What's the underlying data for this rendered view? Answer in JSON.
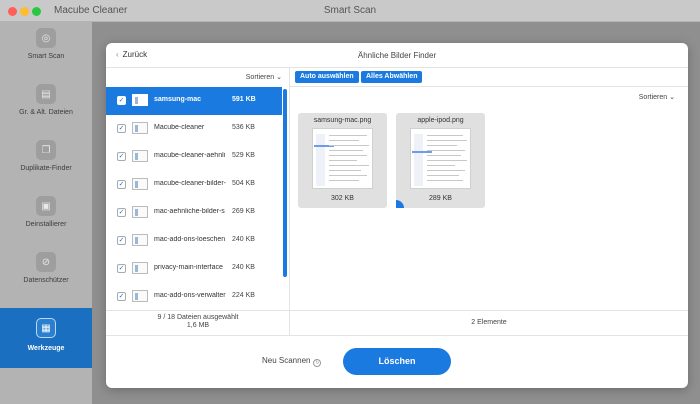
{
  "window": {
    "app_name": "Macube Cleaner",
    "title": "Smart Scan"
  },
  "sidebar": {
    "items": [
      {
        "label": "Smart Scan",
        "icon": "target-icon"
      },
      {
        "label": "Gr. & Alt. Dateien",
        "icon": "document-icon"
      },
      {
        "label": "Duplikate-Finder",
        "icon": "copy-icon"
      },
      {
        "label": "Deinstallierer",
        "icon": "package-icon"
      },
      {
        "label": "Datenschützer",
        "icon": "eye-off-icon"
      },
      {
        "label": "Werkzeuge",
        "icon": "toolbox-icon",
        "active": true
      }
    ]
  },
  "modal": {
    "back_label": "Zurück",
    "title": "Ähnliche Bilder Finder",
    "left": {
      "sort_label": "Sortieren",
      "files": [
        {
          "name": "samsung-mac",
          "size": "591 KB",
          "checked": true,
          "selected": true
        },
        {
          "name": "Macube-cleaner",
          "size": "536 KB",
          "checked": true,
          "selected": false
        },
        {
          "name": "macube-cleaner-aehnli",
          "size": "529 KB",
          "checked": true,
          "selected": false
        },
        {
          "name": "macube-cleaner-bilder-",
          "size": "504 KB",
          "checked": true,
          "selected": false
        },
        {
          "name": "mac-aehnliche-bilder-s",
          "size": "269 KB",
          "checked": true,
          "selected": false
        },
        {
          "name": "mac-add-ons-loeschen",
          "size": "240 KB",
          "checked": true,
          "selected": false
        },
        {
          "name": "privacy-main-interface",
          "size": "240 KB",
          "checked": true,
          "selected": false
        },
        {
          "name": "mac-add-ons-verwalter",
          "size": "224 KB",
          "checked": true,
          "selected": false
        }
      ],
      "status_line1": "9 / 18 Dateien ausgewählt",
      "status_line2": "1,6 MB"
    },
    "right": {
      "auto_select_label": "Auto auswählen",
      "deselect_all_label": "Alles Abwählen",
      "sort_label": "Sortieren",
      "images": [
        {
          "name": "samsung-mac.png",
          "size": "302 KB"
        },
        {
          "name": "apple-ipod.png",
          "size": "289 KB"
        }
      ],
      "status": "2 Elemente"
    },
    "rescan_label": "Neu Scannen",
    "delete_label": "Löschen"
  },
  "colors": {
    "accent": "#1a7ae0",
    "sidebar_active": "#1a6fc0",
    "sidebar_bg": "#b3b3b3"
  }
}
